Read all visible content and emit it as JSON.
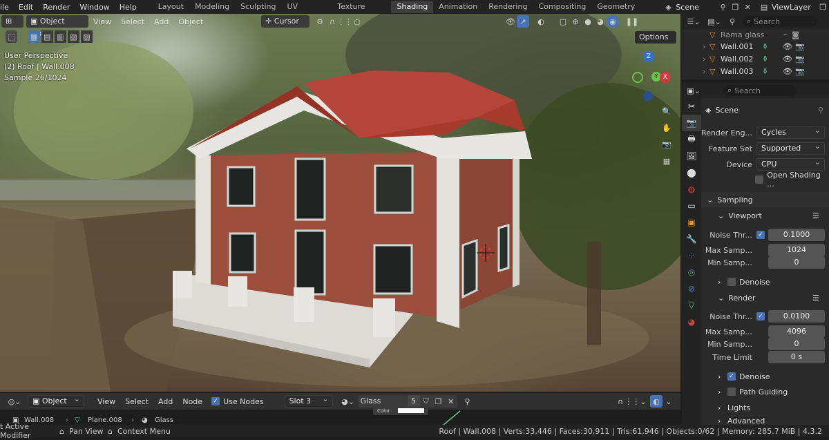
{
  "topbar": {
    "menus": [
      "ile",
      "Edit",
      "Render",
      "Window",
      "Help"
    ],
    "workspaces": [
      "Layout",
      "Modeling",
      "Sculpting",
      "UV Editing",
      "Texture Paint",
      "Shading",
      "Animation",
      "Rendering",
      "Compositing",
      "Geometry Node"
    ],
    "active_workspace": "Shading",
    "scene": "Scene",
    "viewlayer": "ViewLayer"
  },
  "viewport_header": {
    "mode": "Object Mode",
    "menus": [
      "View",
      "Select",
      "Add",
      "Object"
    ],
    "transform": "Cursor",
    "options": "Options"
  },
  "viewport_info": {
    "line1": "User Perspective",
    "line2": "(2) Roof | Wall.008",
    "line3": "Sample 26/1024"
  },
  "gizmo": {
    "z": "Z",
    "y": "Y",
    "x": "X"
  },
  "outliner": {
    "search_placeholder": "Search",
    "items": [
      "Rama glass",
      "Wall.001",
      "Wall.002",
      "Wall.003"
    ]
  },
  "properties": {
    "search_placeholder": "Search",
    "header": "Scene",
    "render_engine_label": "Render Eng...",
    "render_engine": "Cycles",
    "feature_set_label": "Feature Set",
    "feature_set": "Supported",
    "device_label": "Device",
    "device": "CPU",
    "open_shading": "Open Shading ...",
    "sampling": "Sampling",
    "viewport": "Viewport",
    "noise_label": "Noise Thr...",
    "vp_noise": "0.1000",
    "max_samples_label": "Max Samp...",
    "vp_max": "1024",
    "min_samples_label": "Min Samp...",
    "vp_min": "0",
    "denoise": "Denoise",
    "render": "Render",
    "r_noise": "0.0100",
    "r_max": "4096",
    "r_min": "0",
    "time_limit_label": "Time Limit",
    "time_limit": "0 s",
    "path_guiding": "Path Guiding",
    "lights": "Lights",
    "advanced": "Advanced"
  },
  "node_header": {
    "object": "Object",
    "menus": [
      "View",
      "Select",
      "Add",
      "Node"
    ],
    "use_nodes": "Use Nodes",
    "slot": "Slot 3",
    "material": "Glass",
    "users": "5",
    "color_label": "Color"
  },
  "breadcrumb": [
    "Wall.008",
    "Plane.008",
    "Glass"
  ],
  "status": {
    "left1": "t Active Modifier",
    "left2": "Pan View",
    "left3": "Context Menu",
    "right": "Roof | Wall.008 | Verts:33,446 | Faces:30,911 | Tris:61,946 | Objects:0/62 | Memory: 285.7 MiB | 4.3.2"
  },
  "colors": {
    "accent": "#4772b3",
    "roof": "#a63a2c",
    "brick": "#9a4e3b",
    "stone": "#e4e1dc"
  }
}
